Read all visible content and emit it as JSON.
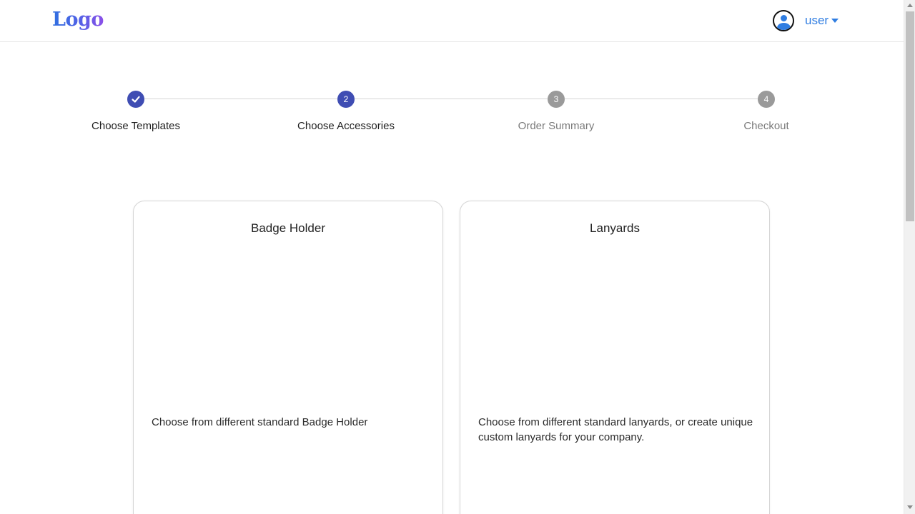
{
  "header": {
    "logo": "Logo",
    "user_icon": "user-circle-icon",
    "user_label": "user",
    "caret_icon": "caret-down-icon"
  },
  "stepper": {
    "steps": [
      {
        "number": "1",
        "label": "Choose Templates",
        "state": "completed",
        "icon": "check-icon"
      },
      {
        "number": "2",
        "label": "Choose Accessories",
        "state": "active"
      },
      {
        "number": "3",
        "label": "Order Summary",
        "state": "pending"
      },
      {
        "number": "4",
        "label": "Checkout",
        "state": "pending"
      }
    ]
  },
  "cards": [
    {
      "title": "Badge Holder",
      "description": "Choose from different standard Badge Holder"
    },
    {
      "title": "Lanyards",
      "description": "Choose from different standard lanyards, or create unique custom lanyards for your company."
    }
  ],
  "colors": {
    "accent": "#3f4db3",
    "link": "#2f7de1",
    "pending": "#9a9a9a"
  }
}
